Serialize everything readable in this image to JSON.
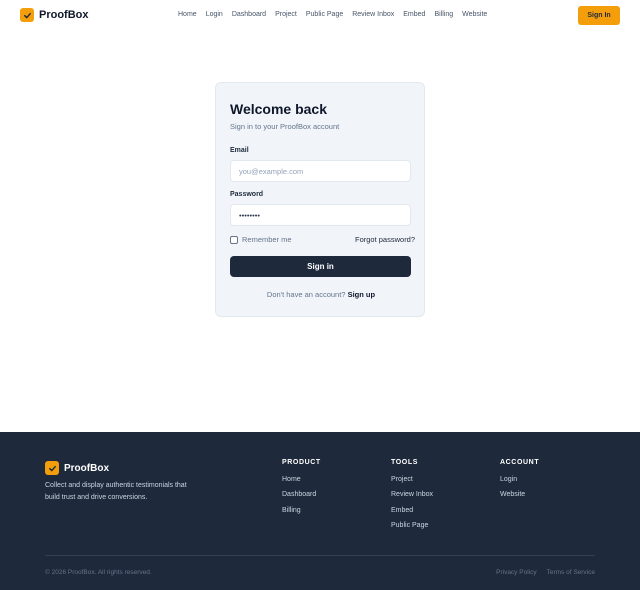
{
  "header": {
    "brand": "ProofBox",
    "nav": [
      "Home",
      "Login",
      "Dashboard",
      "Project",
      "Public Page",
      "Review Inbox",
      "Embed",
      "Billing",
      "Website"
    ],
    "signin_label": "Sign In"
  },
  "card": {
    "title": "Welcome back",
    "subtitle": "Sign in to your ProofBox account",
    "email_label": "Email",
    "email_placeholder": "you@example.com",
    "password_label": "Password",
    "password_value": "••••••••",
    "remember_label": "Remember me",
    "forgot_label": "Forgot password?",
    "submit_label": "Sign in",
    "signup_prompt": "Don't have an account?",
    "signup_link": "Sign up"
  },
  "footer": {
    "brand": "ProofBox",
    "description": "Collect and display authentic testimonials that build trust and drive conversions.",
    "columns": [
      {
        "title": "PRODUCT",
        "links": [
          "Home",
          "Dashboard",
          "Billing"
        ]
      },
      {
        "title": "TOOLS",
        "links": [
          "Project",
          "Review Inbox",
          "Embed",
          "Public Page"
        ]
      },
      {
        "title": "ACCOUNT",
        "links": [
          "Login",
          "Website"
        ]
      }
    ],
    "copyright": "© 2026 ProofBox. All rights reserved.",
    "privacy": "Privacy Policy",
    "terms": "Terms of Service"
  },
  "colors": {
    "accent": "#f59e0b",
    "dark": "#1e293b",
    "card_bg": "#f1f5f9"
  },
  "icons": {
    "logo": "check-icon"
  }
}
